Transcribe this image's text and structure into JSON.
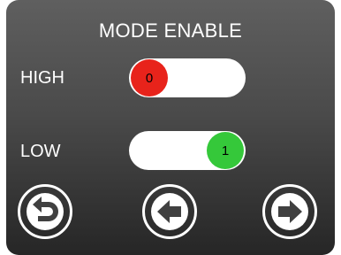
{
  "screen": {
    "title": "MODE ENABLE"
  },
  "modes": [
    {
      "label": "HIGH",
      "state": "0",
      "enabled": false,
      "color": "#e8231b"
    },
    {
      "label": "LOW",
      "state": "1",
      "enabled": true,
      "color": "#35c83a"
    }
  ],
  "nav": {
    "back_icon": "return-arrow-icon",
    "prev_icon": "arrow-left-icon",
    "next_icon": "arrow-right-icon"
  }
}
